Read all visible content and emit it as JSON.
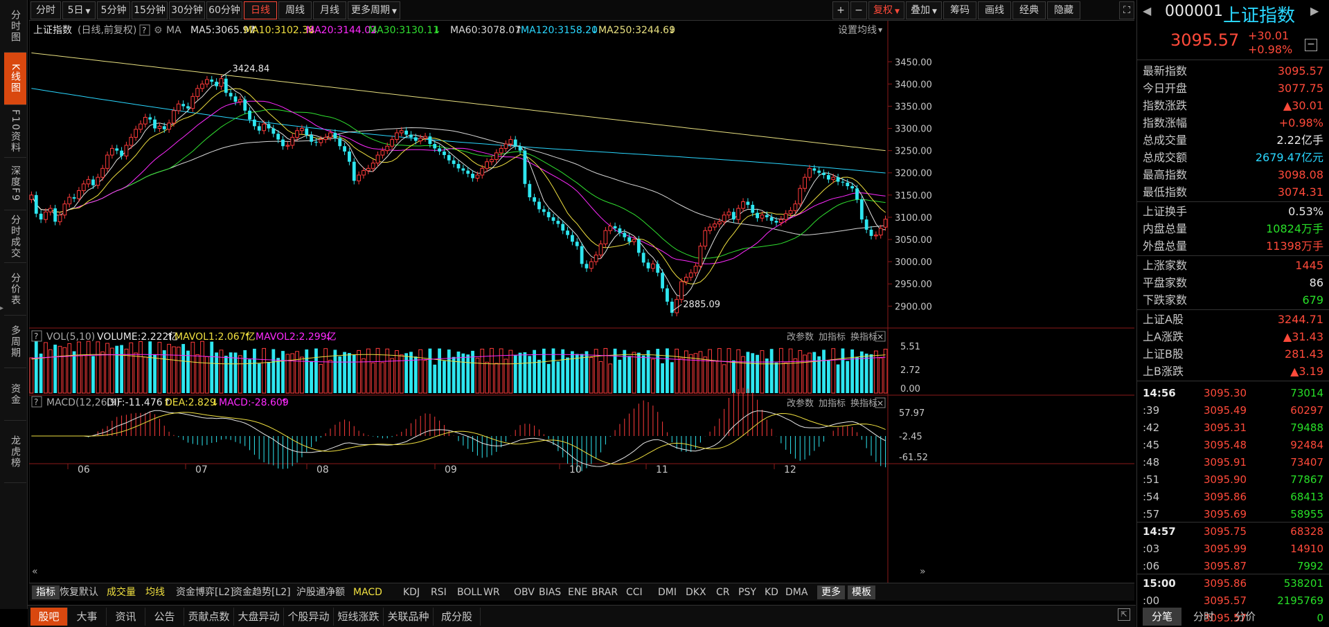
{
  "left_nav": [
    {
      "label": "分时图",
      "active": false
    },
    {
      "label": "K线图",
      "active": true
    },
    {
      "label": "F10资料",
      "active": false
    },
    {
      "label": "深度F9",
      "active": false
    },
    {
      "label": "分时成交",
      "active": false
    },
    {
      "label": "分价表",
      "active": false
    },
    {
      "label": "多周期",
      "active": false
    },
    {
      "label": "资金",
      "active": false
    },
    {
      "label": "龙虎榜",
      "active": false
    }
  ],
  "toolbar": {
    "periods": [
      "分时",
      "5日",
      "5分钟",
      "15分钟",
      "30分钟",
      "60分钟",
      "日线",
      "周线",
      "月线",
      "更多周期"
    ],
    "active_period": "日线",
    "right_buttons": [
      "+",
      "−",
      "复权",
      "叠加",
      "筹码",
      "画线",
      "经典",
      "隐藏"
    ]
  },
  "kline_header": {
    "name": "上证指数",
    "mode": "(日线,前复权)",
    "ma_label": "MA",
    "ma_items": [
      {
        "text": "MA5:3065.97",
        "arrow": "↑",
        "color": "#e0e0e0"
      },
      {
        "text": "MA10:3102.38",
        "arrow": "↓",
        "color": "#f0e040"
      },
      {
        "text": "MA20:3144.02",
        "arrow": "↓",
        "color": "#ff2aff"
      },
      {
        "text": "MA30:3130.11",
        "arrow": "↓",
        "color": "#30e030"
      },
      {
        "text": "MA60:3078.07",
        "arrow": "↑",
        "color": "#d8d8d8"
      },
      {
        "text": "MA120:3158.20",
        "arrow": "↓",
        "color": "#2ad7ff"
      },
      {
        "text": "MA250:3244.69",
        "arrow": "↓",
        "color": "#e8e080"
      }
    ],
    "settings": "设置均线"
  },
  "vol_header": {
    "title": "VOL(5,10)",
    "items": [
      {
        "text": "VOLUME:2.222亿",
        "arrow": "↑",
        "color": "#e8e8e8"
      },
      {
        "text": "MAVOL1:2.067亿",
        "arrow": "↑",
        "color": "#f0e040"
      },
      {
        "text": "MAVOL2:2.299亿",
        "arrow": "↓",
        "color": "#ff2aff"
      }
    ]
  },
  "macd_header": {
    "title": "MACD(12,26,9)",
    "items": [
      {
        "text": "DIF:-11.476",
        "arrow": "↑",
        "color": "#e8e8e8"
      },
      {
        "text": "DEA:2.829",
        "arrow": "↓",
        "color": "#f0e040"
      },
      {
        "text": "MACD:-28.609",
        "arrow": "↑",
        "color": "#ff2aff"
      }
    ]
  },
  "panel_links": [
    "改参数",
    "加指标",
    "换指标"
  ],
  "indicator_bar": {
    "tabs": [
      "指标",
      "恢复默认",
      "成交量",
      "均线",
      "资金博弈[L2]",
      "资金趋势[L2]",
      "沪股通净额",
      "MACD",
      "KDJ",
      "RSI",
      "BOLL",
      "WR",
      "OBV",
      "BIAS",
      "ENE",
      "BRAR",
      "CCI",
      "DMI",
      "DKX",
      "CR",
      "PSY",
      "KD",
      "DMA",
      "更多",
      "模板"
    ]
  },
  "bottom_tabs": [
    "股吧",
    "大事",
    "资讯",
    "公告",
    "贡献点数",
    "大盘异动",
    "个股异动",
    "短线涨跌",
    "关联品种",
    "成分股"
  ],
  "right_panel": {
    "code": "000001",
    "name": "上证指数",
    "price": "3095.57",
    "change": "+30.01",
    "change_pct": "+0.98%",
    "stats1": [
      {
        "k": "最新指数",
        "v": "3095.57",
        "c": "red"
      },
      {
        "k": "今日开盘",
        "v": "3077.75",
        "c": "red"
      },
      {
        "k": "指数涨跌",
        "v": "▲30.01",
        "c": "red"
      },
      {
        "k": "指数涨幅",
        "v": "+0.98%",
        "c": "red"
      },
      {
        "k": "总成交量",
        "v": "2.22亿手",
        "c": "white"
      },
      {
        "k": "总成交额",
        "v": "2679.47亿元",
        "c": "cyan"
      },
      {
        "k": "最高指数",
        "v": "3098.08",
        "c": "red"
      },
      {
        "k": "最低指数",
        "v": "3074.31",
        "c": "red"
      }
    ],
    "stats2": [
      {
        "k": "上证换手",
        "v": "0.53%",
        "c": "white"
      },
      {
        "k": "内盘总量",
        "v": "10824万手",
        "c": "green"
      },
      {
        "k": "外盘总量",
        "v": "11398万手",
        "c": "red"
      }
    ],
    "stats3": [
      {
        "k": "上涨家数",
        "v": "1445",
        "c": "red"
      },
      {
        "k": "平盘家数",
        "v": "86",
        "c": "white"
      },
      {
        "k": "下跌家数",
        "v": "679",
        "c": "green"
      }
    ],
    "stats4": [
      {
        "k": "上证A股",
        "v": "3244.71",
        "c": "red"
      },
      {
        "k": "上A涨跌",
        "v": "▲31.43",
        "c": "red"
      },
      {
        "k": "上证B股",
        "v": "281.43",
        "c": "red"
      },
      {
        "k": "上B涨跌",
        "v": "▲3.19",
        "c": "red"
      }
    ],
    "ticks": [
      {
        "t": "14:56",
        "p": "3095.30",
        "q": "73014",
        "qc": "green",
        "bold": true
      },
      {
        "t": ":39",
        "p": "3095.49",
        "q": "60297",
        "qc": "red"
      },
      {
        "t": ":42",
        "p": "3095.31",
        "q": "79488",
        "qc": "green"
      },
      {
        "t": ":45",
        "p": "3095.48",
        "q": "92484",
        "qc": "red"
      },
      {
        "t": ":48",
        "p": "3095.91",
        "q": "73407",
        "qc": "red"
      },
      {
        "t": ":51",
        "p": "3095.90",
        "q": "77867",
        "qc": "green"
      },
      {
        "t": ":54",
        "p": "3095.86",
        "q": "68413",
        "qc": "green"
      },
      {
        "t": ":57",
        "p": "3095.69",
        "q": "58955",
        "qc": "green"
      },
      {
        "t": "14:57",
        "p": "3095.75",
        "q": "68328",
        "qc": "red",
        "bold": true
      },
      {
        "t": ":03",
        "p": "3095.99",
        "q": "14910",
        "qc": "red"
      },
      {
        "t": ":06",
        "p": "3095.87",
        "q": "7992",
        "qc": "green"
      },
      {
        "t": "15:00",
        "p": "3095.86",
        "q": "538201",
        "qc": "green",
        "bold": true
      },
      {
        "t": ":00",
        "p": "3095.57",
        "q": "2195769",
        "qc": "green"
      },
      {
        "t": ":00",
        "p": "3095.57",
        "q": "0",
        "qc": "green"
      }
    ],
    "bottom_tabs": [
      "分笔",
      "分时",
      "分价"
    ]
  },
  "chart_data": {
    "type": "candlestick",
    "title": "上证指数",
    "x_months": [
      "06",
      "07",
      "08",
      "09",
      "10",
      "11",
      "12"
    ],
    "ylim": [
      2860,
      3480
    ],
    "y_ticks": [
      2900.0,
      2950.0,
      3000.0,
      3050.0,
      3100.0,
      3150.0,
      3200.0,
      3250.0,
      3300.0,
      3350.0,
      3400.0,
      3450.0
    ],
    "annotations": [
      {
        "text": "3424.84",
        "value": 3424.84
      },
      {
        "text": "2885.09",
        "value": 2885.09
      }
    ],
    "close": [
      3150,
      3108,
      3095,
      3112,
      3120,
      3090,
      3105,
      3130,
      3145,
      3142,
      3160,
      3175,
      3185,
      3172,
      3190,
      3210,
      3240,
      3255,
      3250,
      3238,
      3262,
      3280,
      3298,
      3310,
      3325,
      3320,
      3300,
      3305,
      3298,
      3312,
      3340,
      3355,
      3350,
      3345,
      3372,
      3390,
      3400,
      3410,
      3405,
      3395,
      3412,
      3380,
      3372,
      3360,
      3365,
      3340,
      3320,
      3305,
      3295,
      3310,
      3300,
      3288,
      3275,
      3260,
      3262,
      3280,
      3295,
      3300,
      3285,
      3270,
      3268,
      3275,
      3280,
      3290,
      3278,
      3260,
      3248,
      3225,
      3182,
      3195,
      3205,
      3210,
      3222,
      3240,
      3250,
      3260,
      3275,
      3290,
      3295,
      3286,
      3280,
      3272,
      3278,
      3282,
      3265,
      3255,
      3248,
      3240,
      3228,
      3220,
      3210,
      3205,
      3198,
      3188,
      3195,
      3210,
      3225,
      3230,
      3245,
      3255,
      3265,
      3275,
      3260,
      3250,
      3175,
      3145,
      3135,
      3118,
      3112,
      3100,
      3092,
      3085,
      3070,
      3060,
      3045,
      3035,
      2995,
      2985,
      3000,
      3015,
      3040,
      3070,
      3080,
      3075,
      3065,
      3055,
      3045,
      3050,
      3020,
      2998,
      2985,
      2995,
      2975,
      2940,
      2910,
      2885,
      2915,
      2955,
      2965,
      2975,
      2990,
      3035,
      3070,
      3078,
      3085,
      3090,
      3105,
      3112,
      3095,
      3120,
      3135,
      3128,
      3110,
      3098,
      3105,
      3100,
      3092,
      3088,
      3095,
      3108,
      3115,
      3130,
      3165,
      3190,
      3210,
      3205,
      3200,
      3195,
      3185,
      3190,
      3180,
      3178,
      3170,
      3165,
      3140,
      3095,
      3072,
      3058,
      3060,
      3075,
      3095.57
    ],
    "open": [
      3140,
      3150,
      3108,
      3095,
      3112,
      3120,
      3090,
      3105,
      3130,
      3145,
      3142,
      3160,
      3175,
      3185,
      3172,
      3190,
      3210,
      3240,
      3255,
      3250,
      3238,
      3262,
      3280,
      3298,
      3310,
      3325,
      3320,
      3300,
      3305,
      3298,
      3312,
      3340,
      3355,
      3350,
      3345,
      3372,
      3390,
      3400,
      3410,
      3405,
      3395,
      3412,
      3380,
      3372,
      3360,
      3365,
      3340,
      3320,
      3305,
      3295,
      3310,
      3300,
      3288,
      3275,
      3260,
      3262,
      3280,
      3295,
      3300,
      3285,
      3270,
      3268,
      3275,
      3280,
      3290,
      3278,
      3260,
      3248,
      3225,
      3182,
      3195,
      3205,
      3210,
      3222,
      3240,
      3250,
      3260,
      3275,
      3290,
      3295,
      3286,
      3280,
      3272,
      3278,
      3282,
      3265,
      3255,
      3248,
      3240,
      3228,
      3220,
      3210,
      3205,
      3198,
      3188,
      3195,
      3210,
      3225,
      3230,
      3245,
      3255,
      3265,
      3275,
      3260,
      3250,
      3175,
      3145,
      3135,
      3118,
      3112,
      3100,
      3092,
      3085,
      3070,
      3060,
      3045,
      3035,
      2995,
      2985,
      3000,
      3015,
      3040,
      3070,
      3080,
      3075,
      3065,
      3055,
      3045,
      3050,
      3020,
      2998,
      2985,
      2995,
      2975,
      2940,
      2910,
      2885,
      2915,
      2955,
      2965,
      2975,
      2990,
      3035,
      3070,
      3078,
      3085,
      3090,
      3105,
      3112,
      3095,
      3120,
      3135,
      3128,
      3110,
      3098,
      3105,
      3100,
      3092,
      3088,
      3095,
      3108,
      3115,
      3130,
      3165,
      3190,
      3210,
      3205,
      3200,
      3195,
      3185,
      3190,
      3180,
      3178,
      3170,
      3165,
      3140,
      3095,
      3072,
      3058,
      3060,
      3077.75
    ],
    "ma250": [
      3470,
      3250
    ],
    "vol_ticks": [
      "5.51",
      "2.72",
      "0.00"
    ],
    "macd_ticks": [
      "57.97",
      "-2.45",
      "-61.52"
    ]
  }
}
